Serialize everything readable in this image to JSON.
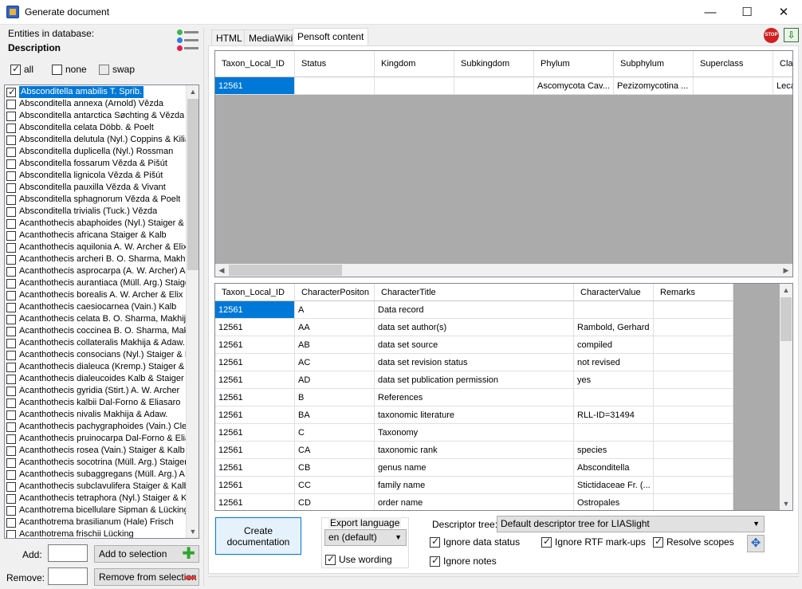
{
  "window": {
    "title": "Generate document",
    "min_glyph": "—",
    "max_glyph": "☐",
    "close_glyph": "✕"
  },
  "left": {
    "entities_label": "Entities in database:",
    "description_label": "Description",
    "all_label": "all",
    "none_label": "none",
    "swap_label": "swap",
    "items": [
      "Absconditella amabilis T. Sprib.",
      "Absconditella annexa (Arnold) Vězda",
      "Absconditella antarctica Søchting & Vězda",
      "Absconditella celata Döbb. & Poelt",
      "Absconditella delutula (Nyl.) Coppins & Kilias",
      "Absconditella duplicella (Nyl.) Rossman",
      "Absconditella fossarum Vězda & Pišút",
      "Absconditella lignicola Vězda & Pišút",
      "Absconditella pauxilla Vězda & Vivant",
      "Absconditella sphagnorum Vězda & Poelt",
      "Absconditella trivialis (Tuck.) Vězda",
      "Acanthothecis abaphoides (Nyl.) Staiger & Kalb",
      "Acanthothecis africana Staiger & Kalb",
      "Acanthothecis aquilonia A. W. Archer & Elix",
      "Acanthothecis archeri B. O. Sharma, Makhija",
      "Acanthothecis asprocarpa (A. W. Archer) A.",
      "Acanthothecis aurantiaca (Müll. Arg.) Staiger",
      "Acanthothecis borealis A. W. Archer & Elix",
      "Acanthothecis caesiocarnea (Vain.) Kalb",
      "Acanthothecis celata B. O. Sharma, Makhija",
      "Acanthothecis coccinea B. O. Sharma, Makhija",
      "Acanthothecis collateralis Makhija & Adaw.",
      "Acanthothecis consocians (Nyl.) Staiger & Kalb",
      "Acanthothecis dialeuca (Kremp.) Staiger & Kalb",
      "Acanthothecis dialeucoides Kalb & Staiger",
      "Acanthothecis gyridia (Stirt.) A. W. Archer",
      "Acanthothecis kalbii Dal-Forno & Eliasaro",
      "Acanthothecis nivalis Makhija & Adaw.",
      "Acanthothecis pachygraphoides (Vain.) Clem",
      "Acanthothecis pruinocarpa Dal-Forno & Eliasaro",
      "Acanthothecis rosea (Vain.) Staiger & Kalb",
      "Acanthothecis socotrina (Müll. Arg.) Staiger &",
      "Acanthothecis subaggregans (Müll. Arg.) A. W.",
      "Acanthothecis subclavulifera Staiger & Kalb",
      "Acanthothecis tetraphora (Nyl.) Staiger & Kalb",
      "Acanthotrema bicellulare Sipman & Lücking",
      "Acanthotrema brasilianum (Hale) Frisch",
      "Acanthotrema frischii Lücking"
    ],
    "add_label": "Add:",
    "remove_label": "Remove:",
    "add_button": "Add to selection",
    "remove_button": "Remove from selection"
  },
  "tabs": [
    "HTML",
    "MediaWiki",
    "Pensoft content"
  ],
  "top_grid": {
    "columns": [
      "Taxon_Local_ID",
      "Status",
      "Kingdom",
      "Subkingdom",
      "Phylum",
      "Subphylum",
      "Superclass",
      "Class"
    ],
    "row": [
      "12561",
      "",
      "",
      "",
      "Ascomycota Cav...",
      "Pezizomycotina ...",
      "",
      "Leca"
    ]
  },
  "bottom_grid": {
    "columns": [
      "Taxon_Local_ID",
      "CharacterPositon",
      "CharacterTitle",
      "CharacterValue",
      "Remarks"
    ],
    "rows": [
      [
        "12561",
        "A",
        "Data record",
        "",
        ""
      ],
      [
        "12561",
        "AA",
        "data set author(s)",
        "Rambold, Gerhard",
        ""
      ],
      [
        "12561",
        "AB",
        "data set source",
        "compiled",
        ""
      ],
      [
        "12561",
        "AC",
        "data set revision status",
        "not revised",
        ""
      ],
      [
        "12561",
        "AD",
        "data set publication permission",
        "yes",
        ""
      ],
      [
        "12561",
        "B",
        "References",
        "",
        ""
      ],
      [
        "12561",
        "BA",
        "taxonomic literature",
        "RLL-ID=31494",
        ""
      ],
      [
        "12561",
        "C",
        "Taxonomy",
        "",
        ""
      ],
      [
        "12561",
        "CA",
        "taxonomic rank",
        "species",
        ""
      ],
      [
        "12561",
        "CB",
        "genus name",
        "Absconditella",
        ""
      ],
      [
        "12561",
        "CC",
        "family name",
        "Stictidaceae Fr. (...",
        ""
      ],
      [
        "12561",
        "CD",
        "order name",
        "Ostropales",
        ""
      ]
    ]
  },
  "bottom": {
    "create_button": "Create\ndocumentation",
    "export_language_label": "Export language",
    "export_language_value": "en (default)",
    "use_wording": "Use wording",
    "descriptor_tree_label": "Descriptor tree:",
    "descriptor_tree_value": "Default descriptor tree for LIASlight",
    "ignore_data_status": "Ignore data status",
    "ignore_rtf": "Ignore RTF mark-ups",
    "resolve_scopes": "Resolve scopes",
    "ignore_notes": "Ignore notes"
  }
}
